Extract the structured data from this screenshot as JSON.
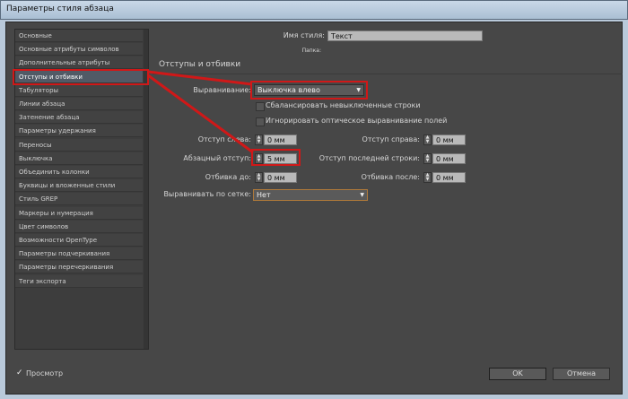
{
  "window": {
    "title": "Параметры стиля абзаца"
  },
  "sidebar": {
    "selected": 3,
    "items": [
      {
        "label": "Основные"
      },
      {
        "label": "Основные атрибуты символов"
      },
      {
        "label": "Дополнительные атрибуты символов"
      },
      {
        "label": "Отступы и отбивки"
      },
      {
        "label": "Табуляторы"
      },
      {
        "label": "Линии абзаца"
      },
      {
        "label": "Затенение абзаца"
      },
      {
        "label": "Параметры удержания"
      },
      {
        "label": "Переносы"
      },
      {
        "label": "Выключка"
      },
      {
        "label": "Объединить колонки"
      },
      {
        "label": "Буквицы и вложенные стили"
      },
      {
        "label": "Стиль GREP"
      },
      {
        "label": "Маркеры и нумерация"
      },
      {
        "label": "Цвет символов"
      },
      {
        "label": "Возможности OpenType"
      },
      {
        "label": "Параметры подчеркивания"
      },
      {
        "label": "Параметры перечеркивания"
      },
      {
        "label": "Теги экспорта"
      }
    ]
  },
  "main": {
    "style_name_label": "Имя стиля:",
    "style_name_value": "Текст",
    "folder_label": "Папка:",
    "section_title": "Отступы и отбивки",
    "alignment_label": "Выравнивание:",
    "alignment_value": "Выключка влево",
    "balance_label": "Сбалансировать невыключенные строки",
    "ignore_optical_label": "Игнорировать оптическое выравнивание полей",
    "left_indent_label": "Отступ слева:",
    "left_indent_value": "0 мм",
    "right_indent_label": "Отступ справа:",
    "right_indent_value": "0 мм",
    "first_line_label": "Абзацный отступ:",
    "first_line_value": "5 мм",
    "last_line_label": "Отступ последней строки:",
    "last_line_value": "0 мм",
    "space_before_label": "Отбивка до:",
    "space_before_value": "0 мм",
    "space_after_label": "Отбивка после:",
    "space_after_value": "0 мм",
    "grid_label": "Выравнивать по сетке:",
    "grid_value": "Нет"
  },
  "footer": {
    "preview_label": "Просмотр",
    "ok_label": "OK",
    "cancel_label": "Отмена"
  },
  "colors": {
    "highlight": "#d01818",
    "panel": "#474747"
  }
}
